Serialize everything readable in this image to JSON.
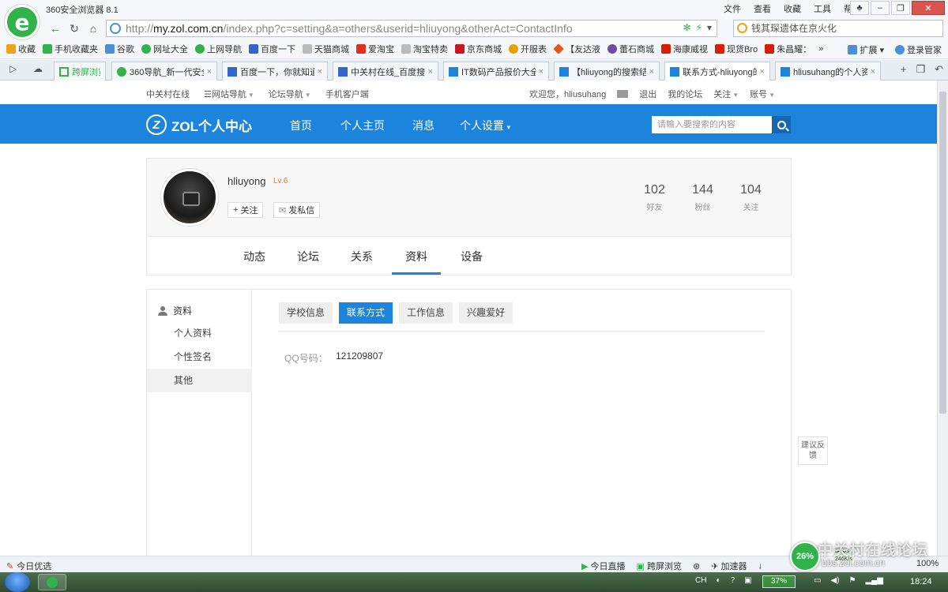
{
  "browser": {
    "app_title": "360安全浏览器 8.1",
    "menu": [
      "文件",
      "查看",
      "收藏",
      "工具",
      "帮助"
    ],
    "url_prefix": "http://",
    "url_host": "my.zol.com.cn",
    "url_path": "/index.php?c=setting&a=others&userid=hliuyong&otherAct=ContactInfo",
    "search_text": "钱其琛遗体在京火化",
    "bookmarks": [
      "收藏",
      "手机收藏夹",
      "谷歌",
      "网址大全",
      "上网导航",
      "百度一下",
      "天猫商城",
      "爱淘宝",
      "淘宝特卖",
      "京东商城",
      "开服表",
      "【友达液",
      "蕾石商城",
      "海康威视",
      "现货Bro",
      "朱昌耀："
    ],
    "bookmark_colors": [
      "#f0a21a",
      "#2fb34a",
      "#4a90d9",
      "#2fb34a",
      "#2fb34a",
      "#3366cc",
      "#999999",
      "#e0301e",
      "#999999",
      "#c81623",
      "#e8a000",
      "#e05a1c",
      "#6c4ea0",
      "#d81e06",
      "#d81e06",
      "#d81e06"
    ],
    "bookmarks_right": [
      "扩展",
      "登录管家"
    ],
    "tabs": [
      {
        "label": "跨屏浏览",
        "icon": "cross-screen-icon"
      },
      {
        "label": "360导航_新一代安全",
        "icon": "360-icon"
      },
      {
        "label": "百度一下，你就知道",
        "icon": "baidu-icon"
      },
      {
        "label": "中关村在线_百度搜索",
        "icon": "baidu-icon"
      },
      {
        "label": "IT数码产品报价大全_",
        "icon": "zol-icon"
      },
      {
        "label": "【hliuyong的搜索结",
        "icon": "zol-icon"
      },
      {
        "label": "联系方式-hliuyong的",
        "icon": "zol-icon"
      },
      {
        "label": "hliusuhang的个人资",
        "icon": "zol-icon"
      }
    ],
    "active_tab": 6
  },
  "topnav": {
    "left": [
      "中关村在线",
      "网站导航",
      "论坛导航",
      "手机客户端"
    ],
    "welcome": "欢迎您，",
    "user": "hliusuhang",
    "logout": "退出",
    "my_forum": "我的论坛",
    "follow": "关注",
    "account": "账号"
  },
  "header": {
    "brand": "ZOL个人中心",
    "nav": [
      "首页",
      "个人主页",
      "消息",
      "个人设置"
    ],
    "search_placeholder": "请输入要搜索的内容"
  },
  "profile": {
    "username": "hliuyong",
    "level": "Lv.6",
    "follow_btn": "关注",
    "message_btn": "发私信",
    "stats": [
      {
        "value": "102",
        "label": "好友"
      },
      {
        "value": "144",
        "label": "粉丝"
      },
      {
        "value": "104",
        "label": "关注"
      }
    ]
  },
  "profile_tabs": [
    "动态",
    "论坛",
    "关系",
    "资料",
    "设备"
  ],
  "sidebar": {
    "title": "资料",
    "items": [
      "个人资料",
      "个性签名",
      "其他"
    ]
  },
  "subtabs": [
    "学校信息",
    "联系方式",
    "工作信息",
    "兴趣爱好"
  ],
  "contact": {
    "qq_label": "QQ号码：",
    "qq_value": "121209807"
  },
  "feedback": "建议反馈",
  "statusbar": {
    "left": "今日优选",
    "items": [
      "今日直播",
      "跨屏浏览",
      "加速器"
    ],
    "speed_pct": "26%",
    "up_speed": "54K/s",
    "down_speed": "246K/s",
    "zoom": "100%"
  },
  "taskbar": {
    "lang": "CH",
    "battery": "37%",
    "time": "18:24"
  },
  "watermark": "中关村在线论坛",
  "watermark_url": "bbs.zol.com.cn"
}
